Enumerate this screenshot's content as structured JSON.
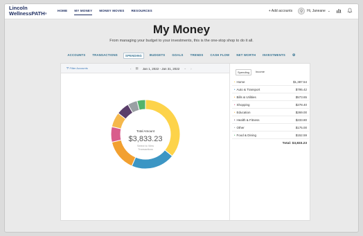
{
  "header": {
    "logo_line1": "Lincoln",
    "logo_line2": "WellnessPATH",
    "logo_trademark": "®",
    "nav": [
      {
        "label": "HOME",
        "active": false
      },
      {
        "label": "MY MONEY",
        "active": true
      },
      {
        "label": "MONEY MOVES",
        "active": false
      },
      {
        "label": "RESOURCES",
        "active": false
      }
    ],
    "add_accounts": "+ Add accounts",
    "user_greeting": "Hi, Janeane",
    "icons": [
      "user-avatar-icon",
      "chevron-down-icon",
      "bar-chart-icon",
      "bell-icon"
    ]
  },
  "page": {
    "title": "My Money",
    "subtitle": "From managing your budget to your investments, this is the one-stop shop to do it all."
  },
  "tabs": [
    {
      "label": "ACCOUNTS",
      "active": false
    },
    {
      "label": "TRANSACTIONS",
      "active": false
    },
    {
      "label": "SPENDING",
      "active": true
    },
    {
      "label": "BUDGETS",
      "active": false
    },
    {
      "label": "GOALS",
      "active": false
    },
    {
      "label": "TRENDS",
      "active": false
    },
    {
      "label": "CASH FLOW",
      "active": false
    },
    {
      "label": "NET WORTH",
      "active": false
    },
    {
      "label": "INVESTMENTS",
      "active": false
    }
  ],
  "card": {
    "filter_label": "Filter Accounts",
    "date_range": "Jan 1, 2022 - Jan 31, 2022",
    "center_label": "Total Amount",
    "center_amount": "$3,833.23",
    "center_hint_line1": "Select to View",
    "center_hint_line2": "Transactions",
    "subtabs": [
      {
        "label": "Spending",
        "active": true
      },
      {
        "label": "Income",
        "active": false
      }
    ],
    "categories": [
      {
        "name": "Home",
        "amount": "$1,387.54",
        "value": 1387.54,
        "color": "#fdd34a"
      },
      {
        "name": "Auto & Transport",
        "amount": "$795.42",
        "value": 795.42,
        "color": "#3c96c4"
      },
      {
        "name": "Bills & Utilities",
        "amount": "$573.65",
        "value": 573.65,
        "color": "#f2a030"
      },
      {
        "name": "Shopping",
        "amount": "$278.40",
        "value": 278.4,
        "color": "#d95c8c"
      },
      {
        "name": "Education",
        "amount": "$269.00",
        "value": 269.0,
        "color": "#f5b84c"
      },
      {
        "name": "Health & Fitness",
        "amount": "$233.80",
        "value": 233.8,
        "color": "#5a3e6a"
      },
      {
        "name": "Other",
        "amount": "$175.00",
        "value": 175.0,
        "color": "#9aa0a4"
      },
      {
        "name": "Food & Dining",
        "amount": "$152.59",
        "value": 152.59,
        "color": "#52b36c"
      }
    ],
    "total": "Total: $3,833.23"
  }
}
